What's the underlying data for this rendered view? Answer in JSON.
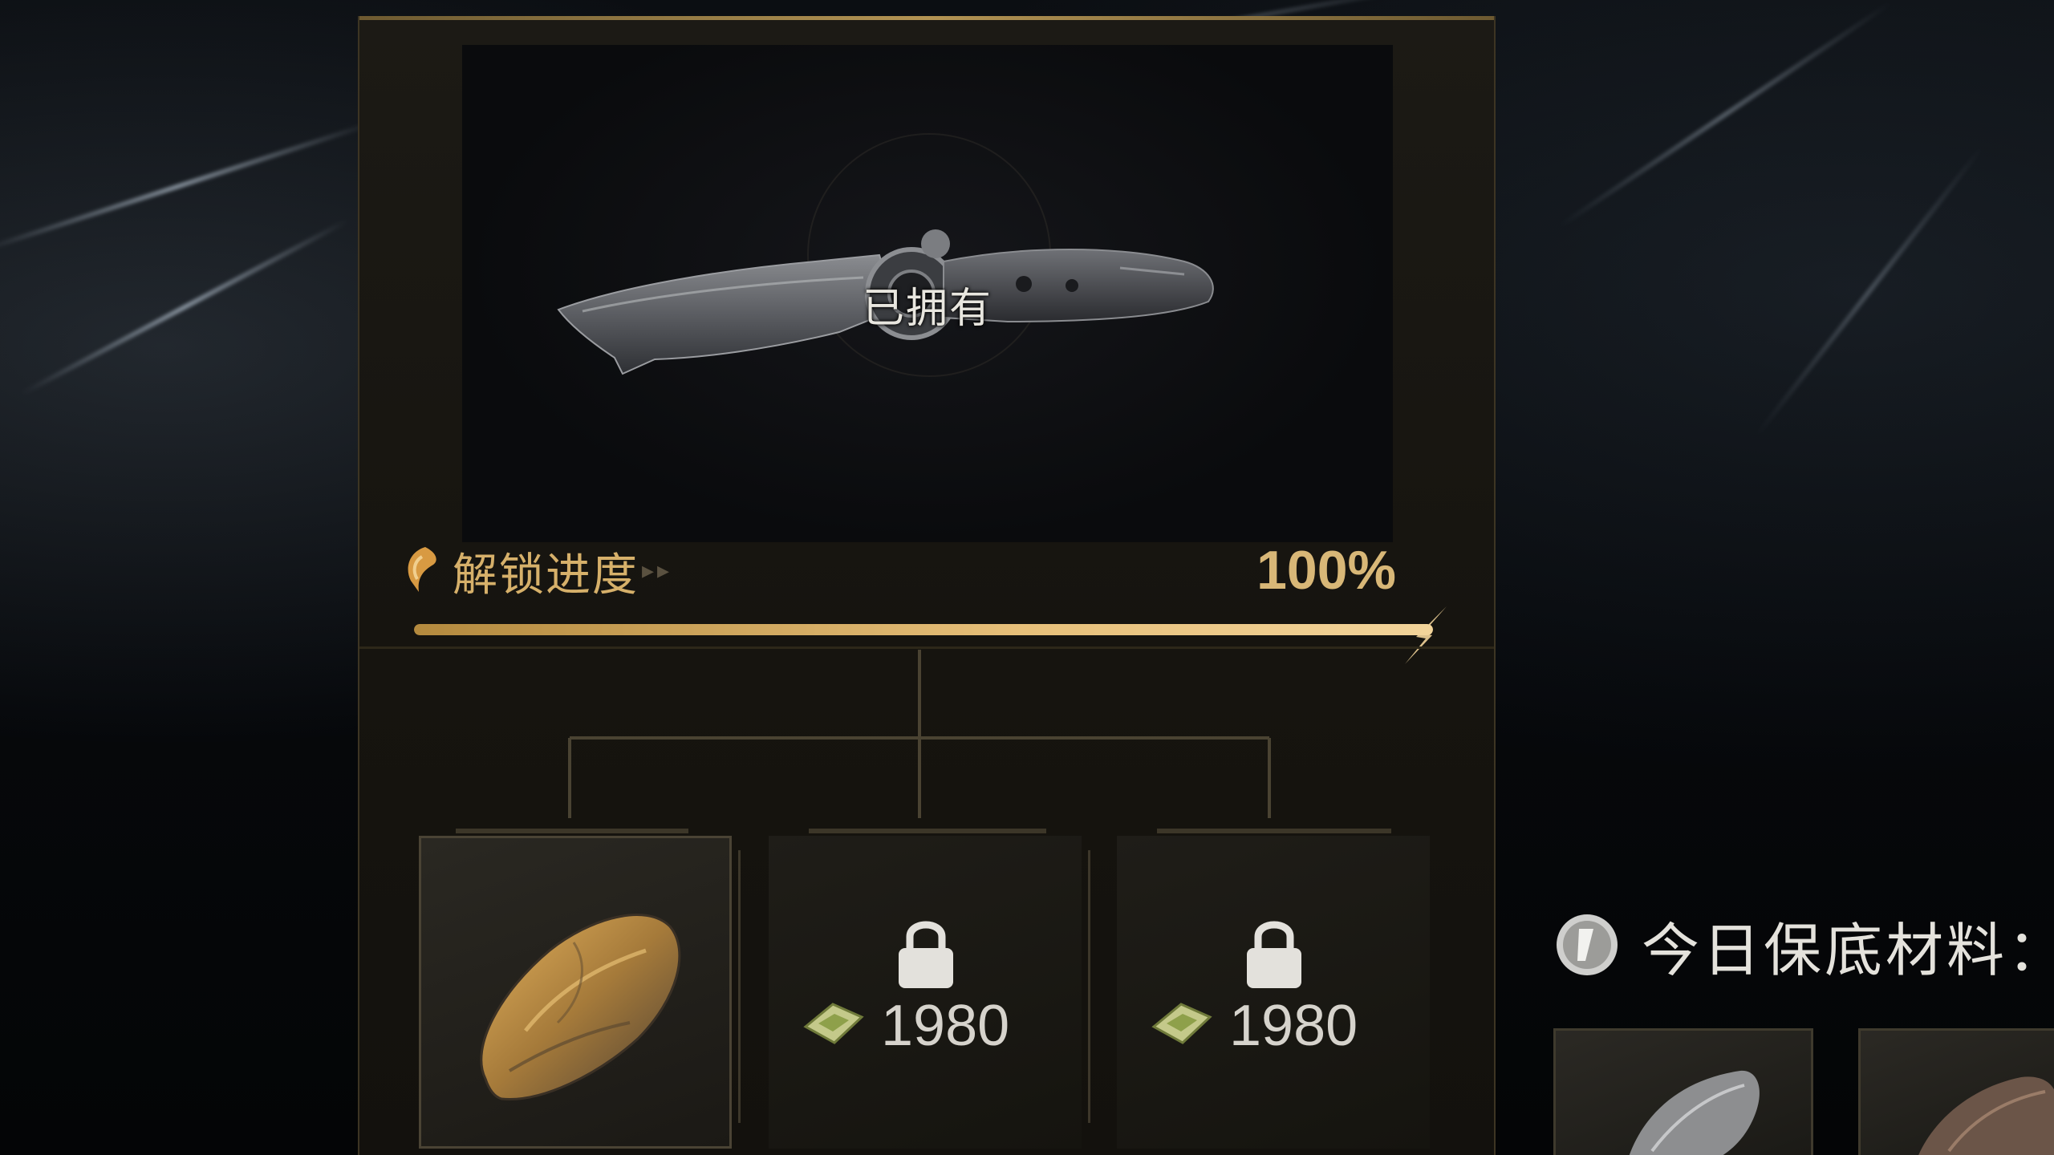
{
  "preview": {
    "owned_label": "已拥有"
  },
  "progress": {
    "label": "解锁进度",
    "arrows": "▸▸",
    "value_text": "100%",
    "fraction": 1.0
  },
  "slots": [
    {
      "state": "unlocked",
      "item_icon": "ore-rock-icon"
    },
    {
      "state": "locked",
      "cost": "1980",
      "currency_icon": "gem-icon"
    },
    {
      "state": "locked",
      "cost": "1980",
      "currency_icon": "gem-icon"
    }
  ],
  "guarantee": {
    "label": "今日保底材料："
  },
  "colors": {
    "gold": "#d6b06a",
    "bar_fill": "#e7c07a",
    "panel_bg": "#1c1a15"
  }
}
